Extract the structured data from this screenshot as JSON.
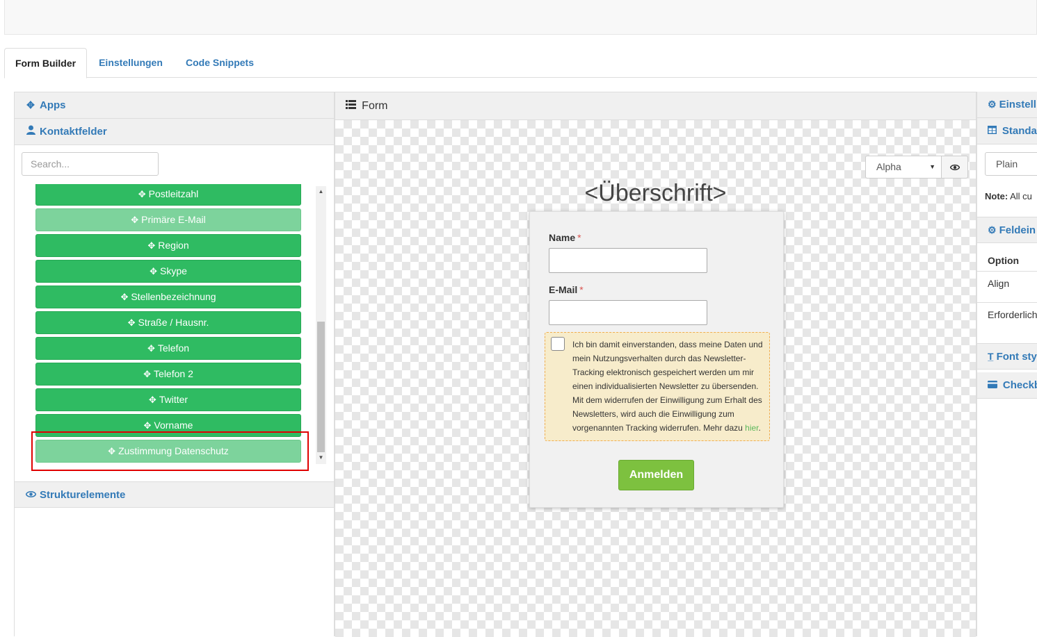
{
  "tabs": [
    {
      "label": "Form Builder",
      "active": true
    },
    {
      "label": "Einstellungen",
      "active": false
    },
    {
      "label": "Code Snippets",
      "active": false
    }
  ],
  "left": {
    "apps_label": "Apps",
    "kontakt_label": "Kontaktfelder",
    "search_placeholder": "Search...",
    "fields": [
      {
        "label": "Postleitzahl",
        "style": "normal"
      },
      {
        "label": "Primäre E-Mail",
        "style": "light"
      },
      {
        "label": "Region",
        "style": "normal"
      },
      {
        "label": "Skype",
        "style": "normal"
      },
      {
        "label": "Stellenbezeichnung",
        "style": "normal"
      },
      {
        "label": "Straße / Hausnr.",
        "style": "normal"
      },
      {
        "label": "Telefon",
        "style": "normal"
      },
      {
        "label": "Telefon 2",
        "style": "normal"
      },
      {
        "label": "Twitter",
        "style": "normal"
      },
      {
        "label": "Vorname",
        "style": "normal"
      },
      {
        "label": "Zustimmung Datenschutz",
        "style": "light"
      }
    ],
    "struktur_label": "Strukturelemente"
  },
  "center": {
    "title": "Form",
    "theme_value": "Alpha",
    "heading": "<Überschrift>",
    "form": {
      "name_label": "Name",
      "email_label": "E-Mail",
      "required_mark": "*",
      "consent_text": "Ich bin damit einverstanden, dass meine Daten und mein Nutzungsverhalten durch das Newsletter-Tracking elektronisch gespeichert werden um mir einen individualisierten Newsletter zu übersenden. Mit dem widerrufen der Einwilligung zum Erhalt des Newsletters, wird auch die Einwilligung zum vorgenannten Tracking widerrufen. Mehr dazu",
      "consent_link": "hier",
      "consent_end": ".",
      "submit_label": "Anmelden"
    }
  },
  "right": {
    "settings_head": "Einstell",
    "standard_head": "Standar",
    "select_value": "Plain",
    "note_bold": "Note:",
    "note_text": "All cu",
    "feld_head": "Feldein",
    "col_option": "Option",
    "row_align": "Align",
    "row_required": "Erforderlich",
    "font_head": "Font sty",
    "checkbox_head": "Checkb"
  },
  "colors": {
    "field_green": "#2fbb62",
    "field_light": "#7dd39c",
    "submit_green": "#7dc13f",
    "link_blue": "#337ab7",
    "highlight_red": "#e00000"
  }
}
